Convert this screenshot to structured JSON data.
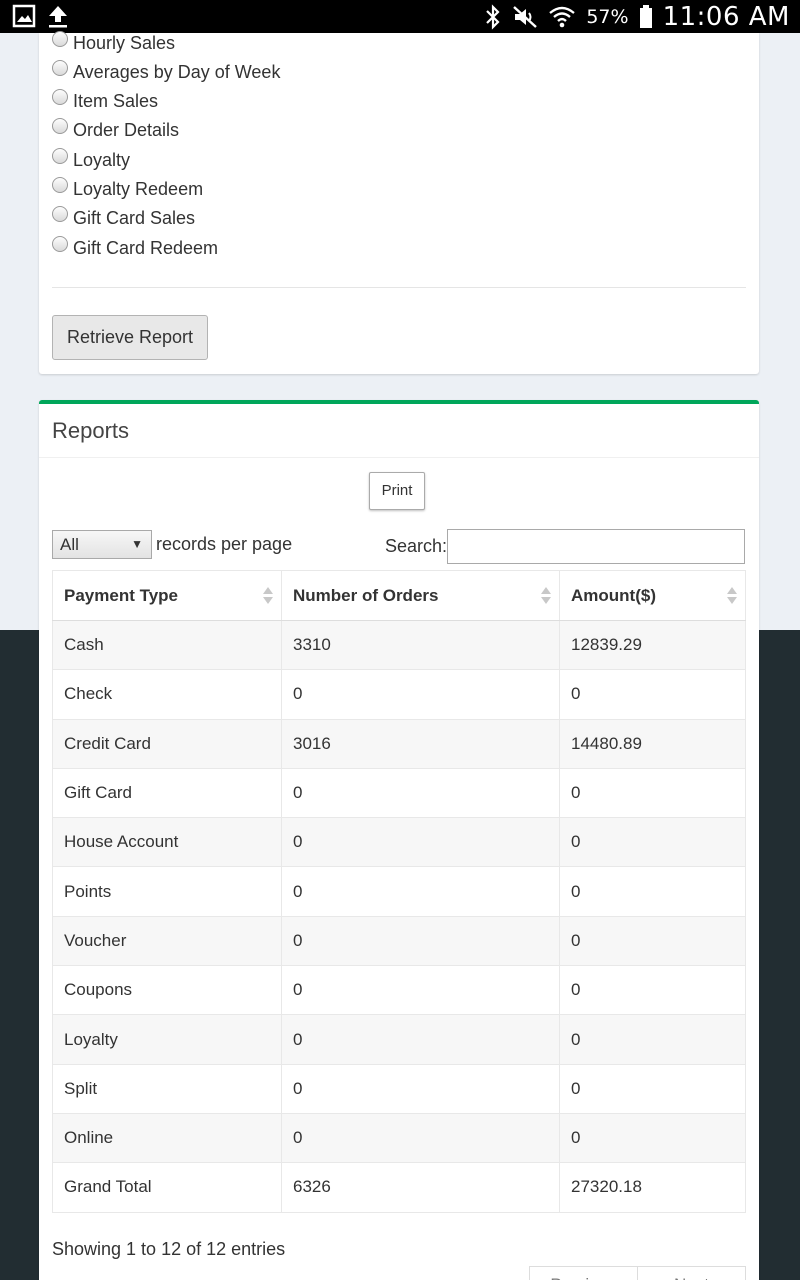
{
  "status_bar": {
    "battery": "57%",
    "time": "11:06 AM",
    "icons": [
      "gallery-icon",
      "upload-icon",
      "bluetooth-icon",
      "mute-icon",
      "wifi-icon",
      "battery-icon"
    ]
  },
  "report_options": {
    "items": [
      {
        "label": "Hourly Sales"
      },
      {
        "label": "Averages by Day of Week"
      },
      {
        "label": "Item Sales"
      },
      {
        "label": "Order Details"
      },
      {
        "label": "Loyalty"
      },
      {
        "label": "Loyalty Redeem"
      },
      {
        "label": "Gift Card Sales"
      },
      {
        "label": "Gift Card Redeem"
      }
    ],
    "retrieve_label": "Retrieve Report"
  },
  "reports": {
    "title": "Reports",
    "print_label": "Print",
    "length_value": "All",
    "length_label": "records per page",
    "search_label": "Search:",
    "search_value": "",
    "columns": [
      "Payment Type",
      "Number of Orders",
      "Amount($)"
    ],
    "rows": [
      [
        "Cash",
        "3310",
        "12839.29"
      ],
      [
        "Check",
        "0",
        "0"
      ],
      [
        "Credit Card",
        "3016",
        "14480.89"
      ],
      [
        "Gift Card",
        "0",
        "0"
      ],
      [
        "House Account",
        "0",
        "0"
      ],
      [
        "Points",
        "0",
        "0"
      ],
      [
        "Voucher",
        "0",
        "0"
      ],
      [
        "Coupons",
        "0",
        "0"
      ],
      [
        "Loyalty",
        "0",
        "0"
      ],
      [
        "Split",
        "0",
        "0"
      ],
      [
        "Online",
        "0",
        "0"
      ],
      [
        "Grand Total",
        "6326",
        "27320.18"
      ]
    ],
    "info": "Showing 1 to 12 of 12 entries",
    "pager": {
      "previous": "Previous",
      "next": "Next"
    }
  },
  "colors": {
    "accent": "#00a65a",
    "sidebar_dark": "#222d32",
    "page_bg": "#ecf0f5"
  }
}
